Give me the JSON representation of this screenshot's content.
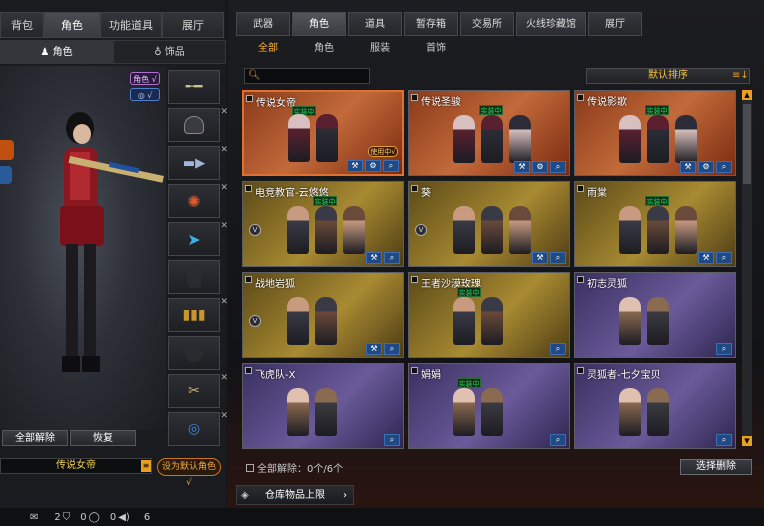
{
  "left": {
    "tabs": [
      "背包",
      "角色",
      "功能道具",
      "展厅"
    ],
    "active_tab": 1,
    "subtabs": [
      {
        "icon": "figure-icon",
        "label": "角色"
      },
      {
        "icon": "bottle-icon",
        "label": "饰品"
      }
    ],
    "preview_tags": [
      "角色 √",
      "◎ √"
    ],
    "slots": [
      "rifle",
      "helmet",
      "gun",
      "emblem",
      "fish",
      "empty",
      "ammo",
      "grenade",
      "knife",
      "bracelet"
    ],
    "unequip_all": "全部解除",
    "restore": "恢复",
    "character_name": "传说女帝",
    "set_default": "设为默认角色 √"
  },
  "bottom": {
    "v1": "2",
    "v2": "0",
    "v3": "0",
    "v4": "6"
  },
  "right": {
    "tabs": [
      "武器",
      "角色",
      "道具",
      "暂存箱",
      "交易所",
      "火线珍藏馆",
      "展厅"
    ],
    "active_tab": 1,
    "filters": [
      "全部",
      "角色",
      "服装",
      "首饰"
    ],
    "active_filter": 0,
    "search_placeholder": "",
    "sort_label": "默认排序",
    "cards": [
      {
        "title": "传说女帝",
        "theme": "orange",
        "badge": "实装中",
        "figs": 2,
        "rank": "",
        "has_cs": true,
        "selected": true,
        "cs": "使用中√"
      },
      {
        "title": "传说圣骏",
        "theme": "orange",
        "badge": "实装中",
        "figs": 3,
        "rank": "",
        "has_cs": false
      },
      {
        "title": "传说影歌",
        "theme": "orange",
        "badge": "实装中",
        "figs": 3,
        "rank": "",
        "has_cs": false
      },
      {
        "title": "电竞教官-云悠悠",
        "theme": "gold",
        "badge": "实装中",
        "figs": 3,
        "rank": "V",
        "has_cs": false
      },
      {
        "title": "葵",
        "theme": "gold",
        "badge": "",
        "figs": 3,
        "rank": "V",
        "has_cs": false
      },
      {
        "title": "雨棠",
        "theme": "gold",
        "badge": "实装中",
        "figs": 3,
        "rank": "",
        "has_cs": false
      },
      {
        "title": "战地岩狐",
        "theme": "gold",
        "badge": "",
        "figs": 2,
        "rank": "V",
        "has_cs": false
      },
      {
        "title": "王者沙漠玫瑰",
        "theme": "gold",
        "badge": "实装中",
        "figs": 2,
        "rank": "",
        "has_cs": false
      },
      {
        "title": "初志灵狐",
        "theme": "purple",
        "badge": "",
        "figs": 2,
        "rank": "",
        "has_cs": false
      },
      {
        "title": "飞虎队-X",
        "theme": "purple",
        "badge": "",
        "figs": 2,
        "rank": "",
        "has_cs": false
      },
      {
        "title": "娟娟",
        "theme": "purple",
        "badge": "实装中",
        "figs": 2,
        "rank": "",
        "has_cs": false
      },
      {
        "title": "灵狐者-七夕宝贝",
        "theme": "purple",
        "badge": "",
        "figs": 2,
        "rank": "",
        "has_cs": false
      }
    ],
    "status": "全部解除：0个/6个",
    "select_delete": "选择删除",
    "warehouse": "仓库物品上限"
  }
}
